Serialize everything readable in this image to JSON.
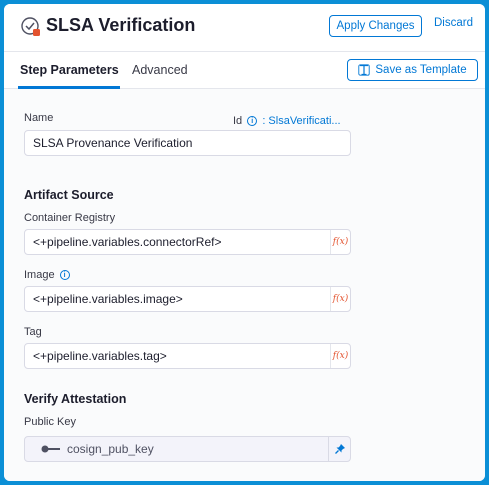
{
  "header": {
    "title": "SLSA Verification",
    "apply_label": "Apply Changes",
    "discard_label": "Discard"
  },
  "tabs": [
    {
      "label": "Step Parameters",
      "active": true
    },
    {
      "label": "Advanced",
      "active": false
    }
  ],
  "save_template_label": "Save as Template",
  "form": {
    "name_label": "Name",
    "id_label": "Id",
    "id_value": ": SlsaVerificati...",
    "name_value": "SLSA Provenance Verification",
    "artifact_section": "Artifact Source",
    "registry_label": "Container Registry",
    "registry_value": "<+pipeline.variables.connectorRef>",
    "image_label": "Image",
    "image_value": "<+pipeline.variables.image>",
    "tag_label": "Tag",
    "tag_value": "<+pipeline.variables.tag>",
    "verify_section": "Verify Attestation",
    "public_key_label": "Public Key",
    "public_key_value": "cosign_pub_key",
    "fx_text": "f(x)"
  },
  "colors": {
    "accent": "#0278d5",
    "fx": "#e3532f",
    "frame": "#0b8fd6"
  }
}
